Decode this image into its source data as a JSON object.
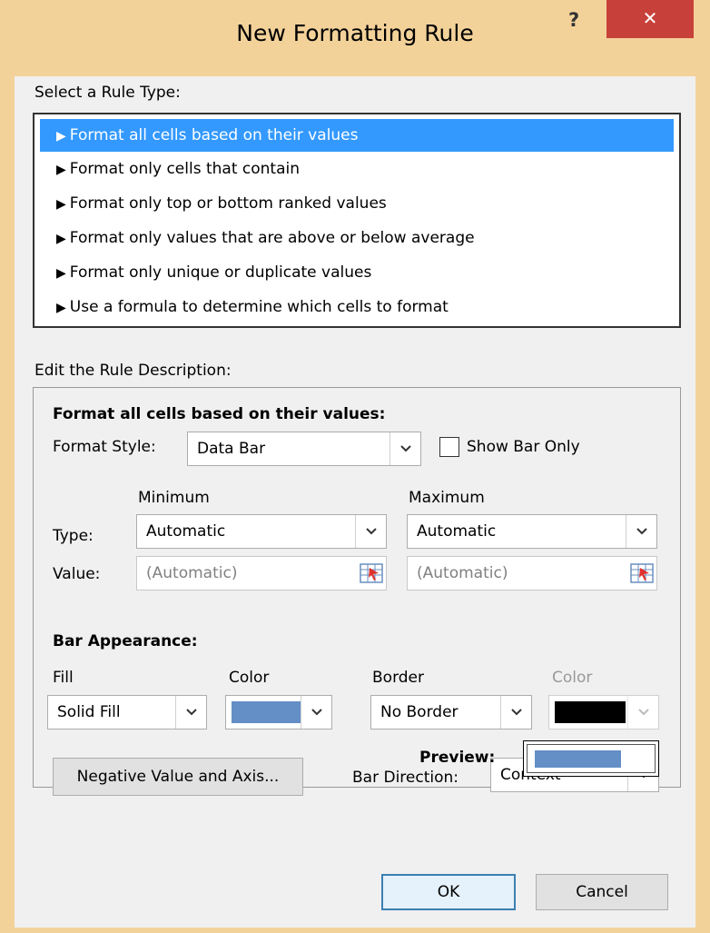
{
  "window": {
    "title": "New Formatting Rule",
    "help_label": "?",
    "close_label": "✕"
  },
  "rule_type": {
    "label": "Select a Rule Type:",
    "selected_index": 0,
    "items": [
      {
        "label": "Format all cells based on their values"
      },
      {
        "label": "Format only cells that contain"
      },
      {
        "label": "Format only top or bottom ranked values"
      },
      {
        "label": "Format only values that are above or below average"
      },
      {
        "label": "Format only unique or duplicate values"
      },
      {
        "label": "Use a formula to determine which cells to format"
      }
    ]
  },
  "description": {
    "label": "Edit the Rule Description:",
    "heading": "Format all cells based on their values:",
    "format_style_label": "Format Style:",
    "format_style_value": "Data Bar",
    "show_bar_only_label": "Show Bar Only",
    "show_bar_only_checked": false,
    "minimum_label": "Minimum",
    "maximum_label": "Maximum",
    "type_label": "Type:",
    "value_label": "Value:",
    "min_type_value": "Automatic",
    "max_type_value": "Automatic",
    "min_value_placeholder": "(Automatic)",
    "max_value_placeholder": "(Automatic)"
  },
  "bar_appearance": {
    "heading": "Bar Appearance:",
    "fill_label": "Fill",
    "fill_value": "Solid Fill",
    "color_label": "Color",
    "fill_color": "#638ec6",
    "border_label": "Border",
    "border_value": "No Border",
    "border_color_label": "Color",
    "border_color": "#000000",
    "negative_button_label": "Negative Value and Axis...",
    "bar_direction_label": "Bar Direction:",
    "bar_direction_value": "Context",
    "preview_label": "Preview:",
    "preview_fill_fraction": 0.75
  },
  "buttons": {
    "ok_label": "OK",
    "cancel_label": "Cancel"
  },
  "colors": {
    "titlebar": "#f3d29a",
    "close_button": "#c7413a",
    "selection": "#3399ff"
  }
}
